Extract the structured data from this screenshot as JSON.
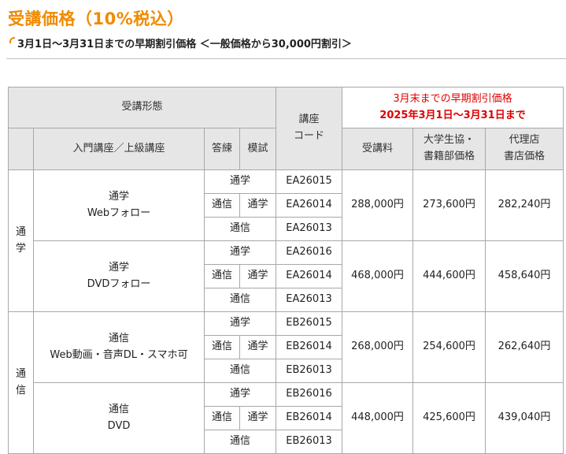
{
  "title": "受講価格（10%税込）",
  "subtitle": "3月1日～3月31日までの早期割引価格 ＜一般価格から30,000円割引＞",
  "headers": {
    "form": "受講形態",
    "course_level": "入門講座／上級講座",
    "answer": "答練",
    "mock": "模試",
    "code_line1": "講座",
    "code_line2": "コード",
    "promo_line1": "3月末までの早期割引価格",
    "promo_line2": "2025年3月1日～3月31日まで",
    "fee": "受講料",
    "coop_line1": "大学生協・",
    "coop_line2": "書籍部価格",
    "agent_line1": "代理店",
    "agent_line2": "書店価格"
  },
  "mode_labels": {
    "tsugaku": "通学",
    "tsushin": "通信"
  },
  "groups": [
    {
      "side_line1": "通",
      "side_line2": "学",
      "courses": [
        {
          "line1": "通学",
          "line2": "Webフォロー",
          "price": "288,000円",
          "coop_price": "273,600円",
          "agent_price": "282,240円",
          "codes": [
            "EA26015",
            "EA26014",
            "EA26013"
          ]
        },
        {
          "line1": "通学",
          "line2": "DVDフォロー",
          "price": "468,000円",
          "coop_price": "444,600円",
          "agent_price": "458,640円",
          "codes": [
            "EA26016",
            "EA26014",
            "EA26013"
          ]
        }
      ]
    },
    {
      "side_line1": "通",
      "side_line2": "信",
      "courses": [
        {
          "line1": "通信",
          "line2": "Web動画・音声DL・スマホ可",
          "price": "268,000円",
          "coop_price": "254,600円",
          "agent_price": "262,640円",
          "codes": [
            "EB26015",
            "EB26014",
            "EB26013"
          ]
        },
        {
          "line1": "通信",
          "line2": "DVD",
          "price": "448,000円",
          "coop_price": "425,600円",
          "agent_price": "439,040円",
          "codes": [
            "EB26016",
            "EB26014",
            "EB26013"
          ]
        }
      ]
    }
  ],
  "colors": {
    "title": "#f08a00",
    "promo_text": "#e00000",
    "header_bg": "#e6e6e6",
    "border": "#a8a8a8"
  }
}
